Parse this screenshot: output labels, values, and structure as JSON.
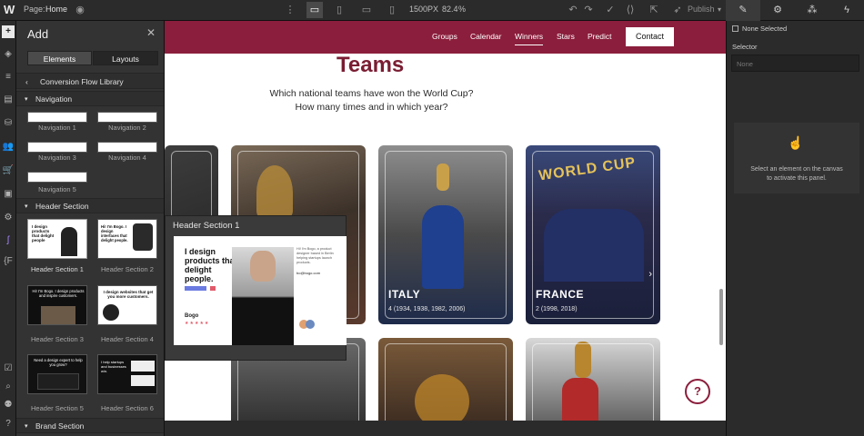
{
  "topbar": {
    "logo": "W",
    "page_label": "Page:",
    "page_name": "Home",
    "width_value": "1500",
    "width_unit": "PX",
    "zoom": "82.4",
    "zoom_unit": "%",
    "publish_label": "Publish"
  },
  "rail": {
    "icons": [
      "add-icon",
      "box-icon",
      "navigator-icon",
      "pages-icon",
      "cms-icon",
      "users-icon",
      "ecommerce-icon",
      "assets-icon",
      "settings-icon",
      "logic-icon",
      "code-icon",
      "audit-icon",
      "search-icon",
      "apps-icon",
      "help-icon"
    ]
  },
  "addpanel": {
    "title": "Add",
    "tabs": [
      "Elements",
      "Layouts"
    ],
    "library_label": "Conversion Flow Library",
    "sections": [
      {
        "label": "Navigation",
        "items": [
          "Navigation 1",
          "Navigation 2",
          "Navigation 3",
          "Navigation 4",
          "Navigation 5"
        ]
      },
      {
        "label": "Header Section",
        "items": [
          "Header Section 1",
          "Header Section 2",
          "Header Section 3",
          "Header Section 4",
          "Header Section 5",
          "Header Section 6"
        ]
      },
      {
        "label": "Brand Section",
        "items": []
      }
    ],
    "thumb_texts": {
      "h1": "I design products that delight people",
      "h2": "Hi! I'm Bogo. I design interfaces that delight people.",
      "h3": "Hi! I'm Bogo. I design products and inspire customers.",
      "h4": "I design websites that get you more customers.",
      "h5": "Need a design expert to help you grow?",
      "h6": "I help startups and businesses win."
    }
  },
  "preview": {
    "title": "Header Section 1",
    "headline": "I design products that delight people.",
    "body": "Hi! I'm Bogo, a product designer based in Berlin helping startups launch products.",
    "email": "bo@bogo.com",
    "logo_text": "Bogo",
    "stars": "★★★★★"
  },
  "canvas": {
    "nav": {
      "links": [
        "Groups",
        "Calendar",
        "Winners",
        "Stars",
        "Predict"
      ],
      "cta": "Contact"
    },
    "title": "Teams",
    "question_line1": "Which national teams have won the World Cup?",
    "question_line2": "How many times and in which year?",
    "cards": [
      {
        "team": "",
        "years": ""
      },
      {
        "team": "",
        "years": ""
      },
      {
        "team": "ITALY",
        "years": "4 (1934, 1938, 1982, 2006)"
      },
      {
        "team": "FRANCE",
        "years": "2 (1998, 2018)"
      }
    ],
    "france_banner": "WORLD CUP",
    "help_badge": "?"
  },
  "rightpanel": {
    "tabs": [
      "style-brush-icon",
      "settings-gear-icon",
      "interactions-drops-icon",
      "lightning-icon"
    ],
    "none_selected": "None Selected",
    "selector_label": "Selector",
    "selector_placeholder": "None",
    "empty_message_line1": "Select an element on the canvas",
    "empty_message_line2": "to activate this panel."
  },
  "colors": {
    "brand": "#8b1e3c",
    "title": "#7a1d33",
    "panel": "#333333",
    "dark": "#2b2b2b"
  }
}
